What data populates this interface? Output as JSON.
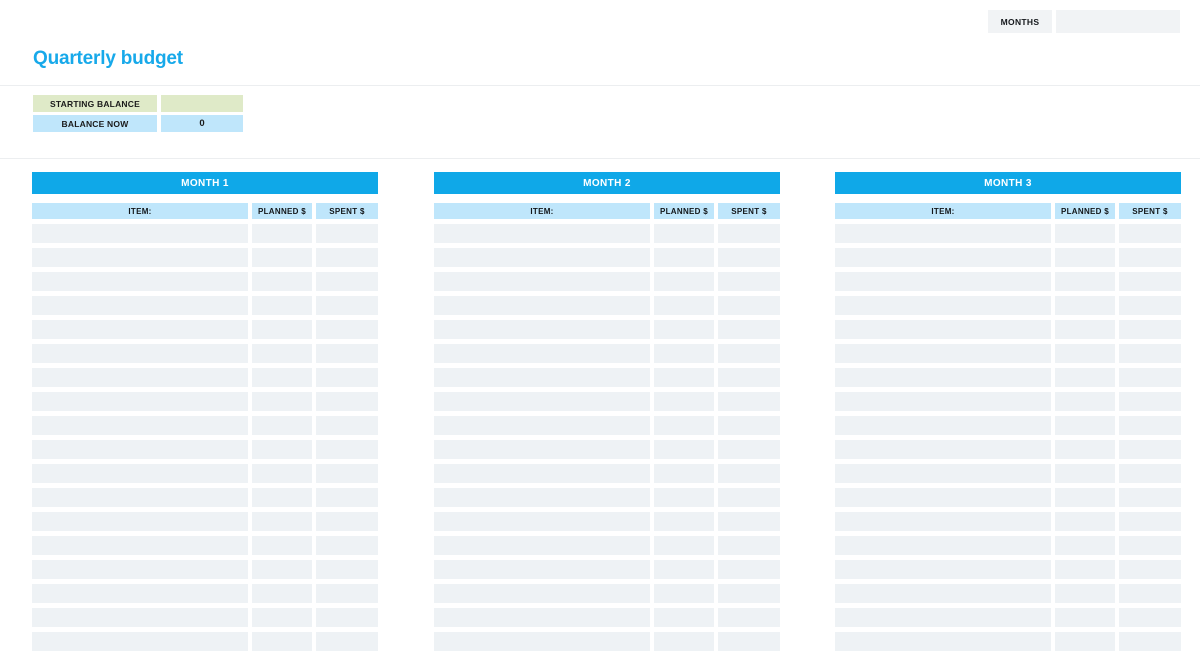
{
  "page": {
    "title": "Quarterly budget",
    "title_color": "#17a9ea",
    "background": "#ffffff"
  },
  "topbar": {
    "months_label": "MONTHS",
    "months_value": "",
    "months_placeholder": ""
  },
  "balance": {
    "rows": [
      {
        "label": "STARTING BALANCE",
        "value": "",
        "color": "#dfeac8"
      },
      {
        "label": "BALANCE NOW",
        "value": "0",
        "color": "#bfe6fb"
      }
    ]
  },
  "tables": {
    "header_color": "#0fa8e8",
    "column_header_color": "#bfe6fb",
    "cell_color": "#eef2f5",
    "columns": [
      "ITEM:",
      "PLANNED $",
      "SPENT $"
    ],
    "empty_row_count": 18,
    "months": [
      {
        "title": "MONTH 1"
      },
      {
        "title": "MONTH 2"
      },
      {
        "title": "MONTH 3"
      }
    ]
  }
}
